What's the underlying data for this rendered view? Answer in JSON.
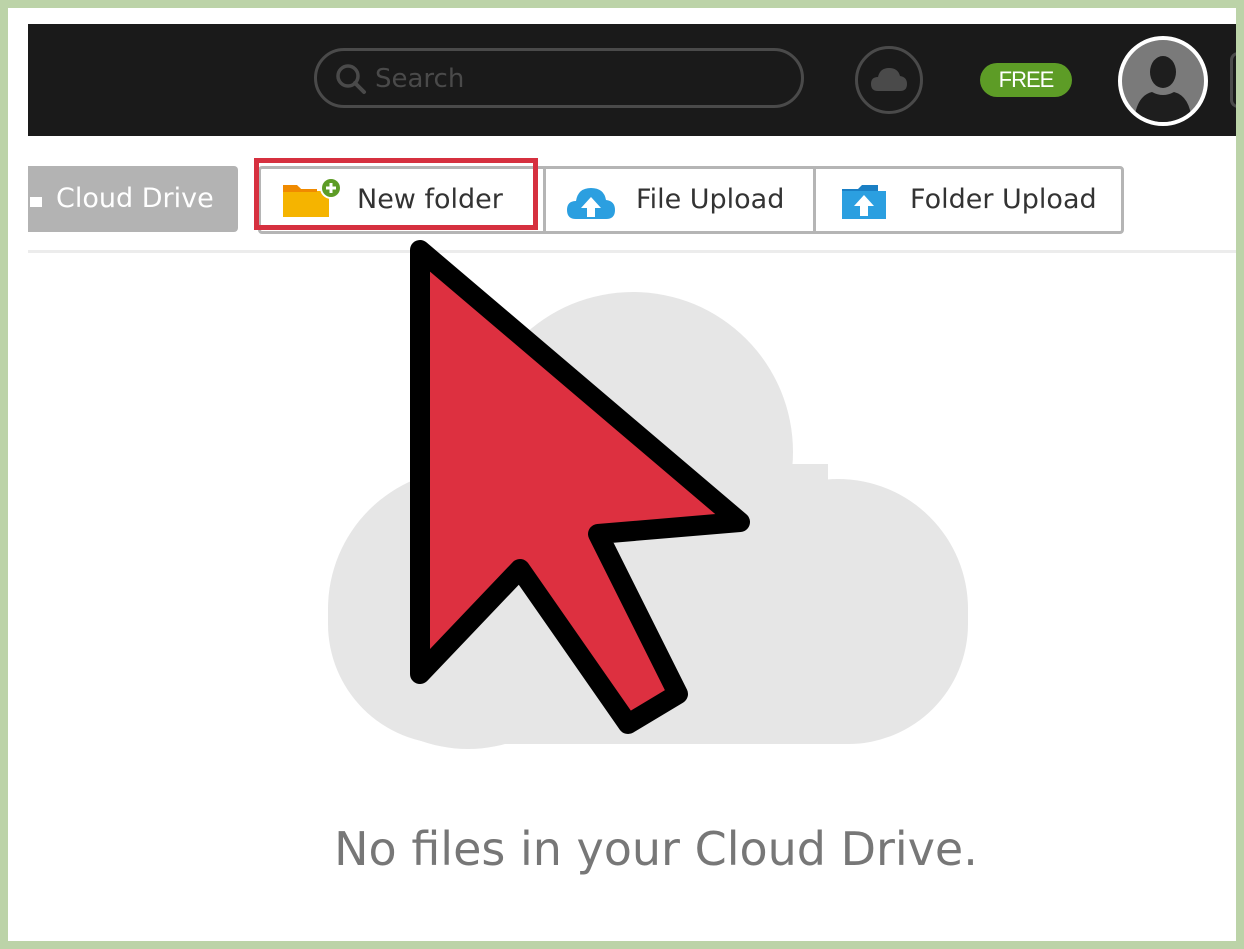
{
  "topbar": {
    "search_placeholder": "Search",
    "plan_badge": "FREE"
  },
  "toolbar": {
    "breadcrumb_label": "Cloud Drive",
    "new_folder_label": "New folder",
    "file_upload_label": "File Upload",
    "folder_upload_label": "Folder Upload"
  },
  "empty_state": {
    "message": "No files in your Cloud Drive."
  },
  "annotation": {
    "highlight_color": "#d6303f",
    "pointer_color": "#dd3040",
    "highlighted_item": "new-folder-button"
  },
  "colors": {
    "topbar_bg": "#1a1a1a",
    "badge_green": "#5d9c26",
    "folder_yellow": "#f5b400",
    "upload_blue": "#2b9fe0",
    "frame_green": "#bcd3a8"
  },
  "icons": [
    "search-icon",
    "cloud-icon",
    "user-avatar-icon",
    "folder-add-icon",
    "cloud-upload-icon",
    "folder-upload-icon"
  ]
}
